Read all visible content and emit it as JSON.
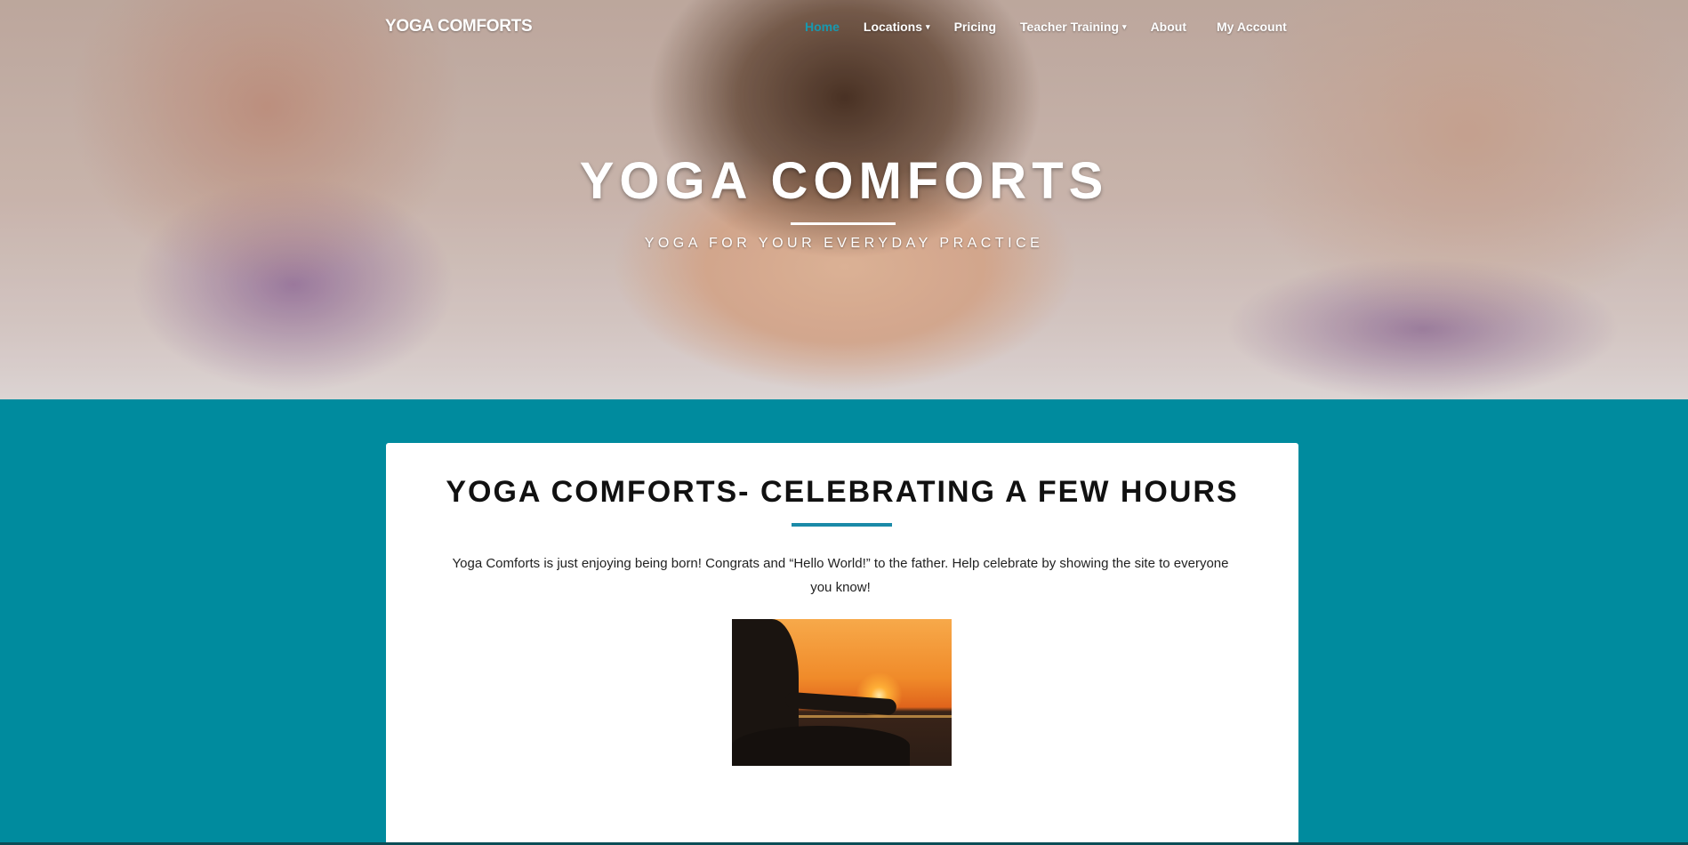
{
  "header": {
    "brand": "YOGA COMFORTS",
    "nav": [
      {
        "label": "Home",
        "active": true,
        "dropdown": false
      },
      {
        "label": "Locations",
        "active": false,
        "dropdown": true
      },
      {
        "label": "Pricing",
        "active": false,
        "dropdown": false
      },
      {
        "label": "Teacher Training",
        "active": false,
        "dropdown": true
      },
      {
        "label": "About",
        "active": false,
        "dropdown": false
      },
      {
        "label": "My Account",
        "active": false,
        "dropdown": false
      }
    ],
    "caret": "▾"
  },
  "hero": {
    "title": "YOGA COMFORTS",
    "subtitle": "YOGA FOR YOUR EVERYDAY PRACTICE"
  },
  "post": {
    "title": "YOGA COMFORTS- CELEBRATING A FEW HOURS",
    "body": "Yoga Comforts is just enjoying being born! Congrats and “Hello World!”  to the father. Help celebrate by showing the site to everyone you know!"
  },
  "colors": {
    "accent": "#1799b0",
    "page_background": "#008b9e",
    "rule": "#1a8aa8"
  }
}
